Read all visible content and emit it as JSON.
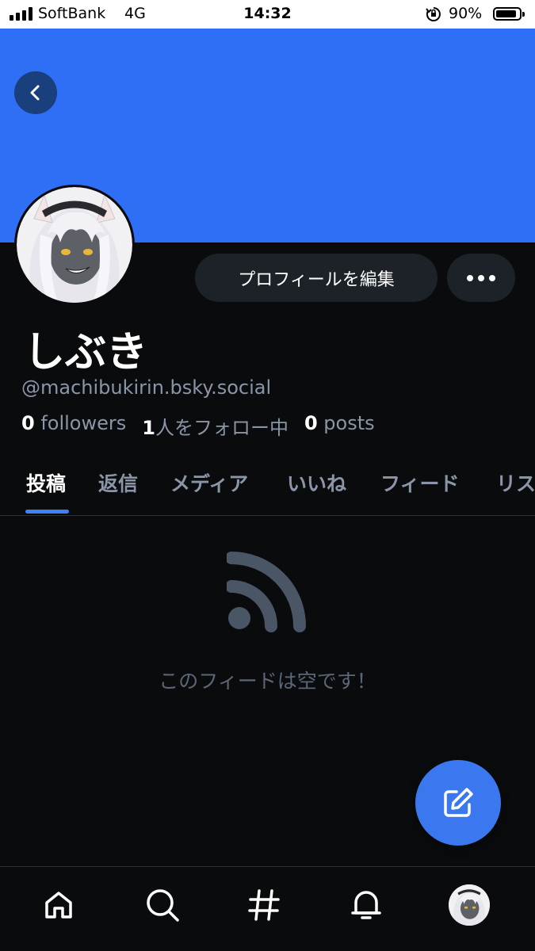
{
  "status_bar": {
    "carrier": "SoftBank",
    "network": "4G",
    "time": "14:32",
    "battery_percent": "90%",
    "battery_level": 0.9
  },
  "banner": {
    "color": "#2f6ff5"
  },
  "profile": {
    "display_name": "しぶき",
    "handle": "@machibukirin.bsky.social",
    "edit_button_label": "プロフィールを編集",
    "stats": {
      "followers_count": "0",
      "followers_label": " followers",
      "following_count": "1",
      "following_label": "人をフォロー中",
      "posts_count": "0",
      "posts_label": " posts"
    }
  },
  "tabs": [
    {
      "label": "投稿",
      "active": true
    },
    {
      "label": "返信"
    },
    {
      "label": "メディア"
    },
    {
      "label": "いいね"
    },
    {
      "label": "フィード"
    },
    {
      "label": "リスト"
    }
  ],
  "feed": {
    "empty_message": "このフィードは空です！",
    "icon": "rss-feed-icon"
  },
  "bottom_nav": {
    "items": [
      {
        "name": "home-icon"
      },
      {
        "name": "search-icon"
      },
      {
        "name": "hashtag-icon"
      },
      {
        "name": "bell-icon"
      },
      {
        "name": "profile-avatar"
      }
    ]
  },
  "colors": {
    "background": "#0a0b0d",
    "accent": "#3b82f6",
    "button_bg": "#1d2228",
    "muted_text": "#8a96a8",
    "fab": "#3b78f0"
  }
}
